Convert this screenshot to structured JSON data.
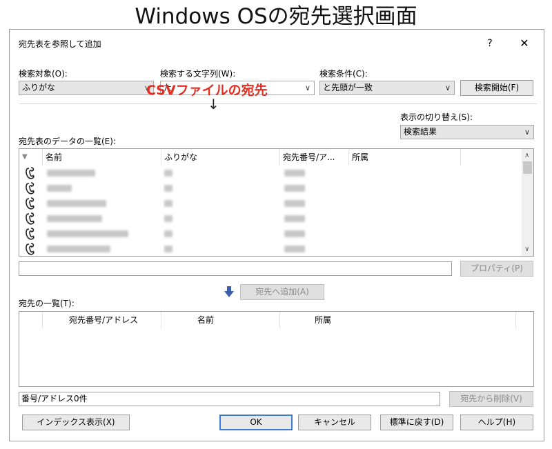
{
  "heading": "Windows OSの宛先選択画面",
  "annotation": {
    "csv_label": "CSVファイルの宛先",
    "arrow": "↓"
  },
  "dialog": {
    "title": "宛先表を参照して追加",
    "help": "?",
    "close": "✕"
  },
  "search": {
    "target_label": "検索対象(O):",
    "target_value": "ふりがな",
    "string_label": "検索する文字列(W):",
    "string_value": "た",
    "condition_label": "検索条件(C):",
    "condition_value": "と先頭が一致",
    "start_button": "検索開始(F)"
  },
  "display_toggle": {
    "label": "表示の切り替え(S):",
    "value": "検索結果"
  },
  "address_list": {
    "label": "宛先表のデータの一覧(E):",
    "sort_icon": "▼",
    "columns": [
      "名前",
      "ふりがな",
      "宛先番号/ア...",
      "所属"
    ],
    "rows": [
      {
        "icon": "phone-icon"
      },
      {
        "icon": "phone-icon"
      },
      {
        "icon": "phone-icon"
      },
      {
        "icon": "phone-icon"
      },
      {
        "icon": "phone-icon"
      },
      {
        "icon": "phone-icon"
      }
    ]
  },
  "properties_button": "プロパティ(P)",
  "add_button": "宛先へ追加(A)",
  "destinations": {
    "label": "宛先の一覧(T):",
    "columns": [
      "宛先番号/アドレス",
      "名前",
      "所属"
    ]
  },
  "status_text": "番号/アドレス0件",
  "remove_button": "宛先から削除(V)",
  "footer": {
    "index_button": "インデックス表示(X)",
    "ok_button": "OK",
    "cancel_button": "キャンセル",
    "reset_button": "標準に戻す(D)",
    "help_button": "ヘルプ(H)"
  },
  "colors": {
    "annotation": "#e32e24",
    "accent": "#3b7fd4",
    "arrow_icon": "#3a5fa8"
  }
}
